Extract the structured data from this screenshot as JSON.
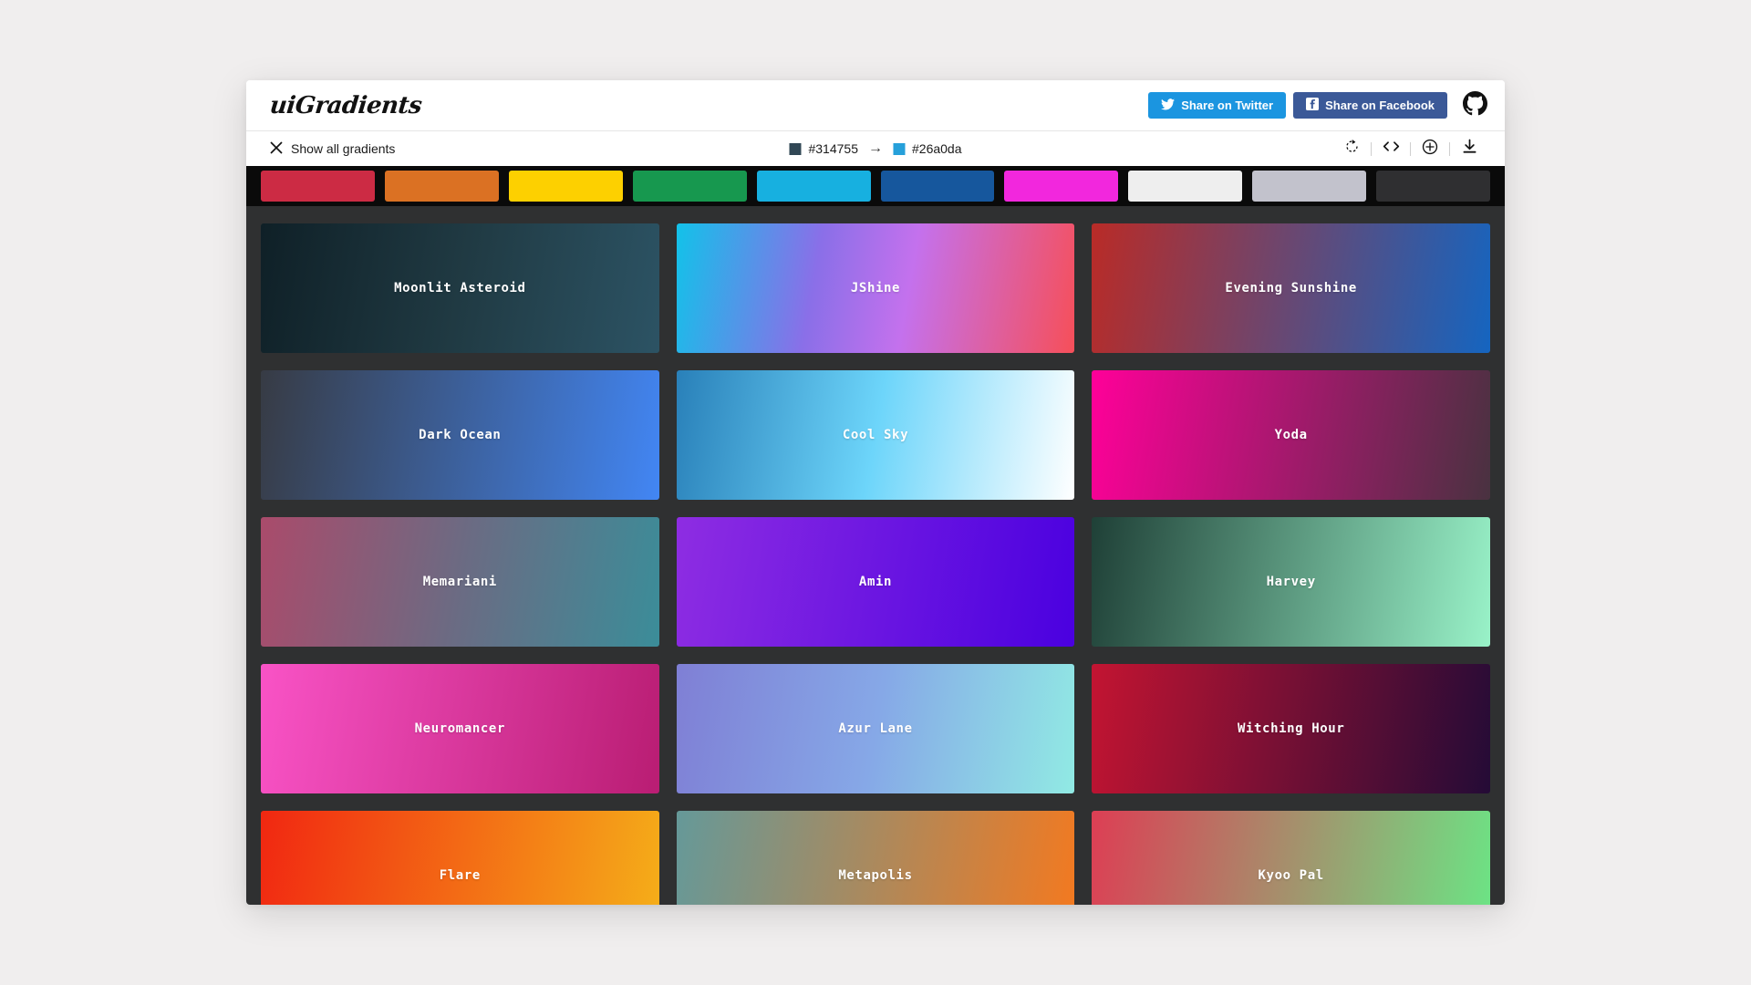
{
  "header": {
    "brand": "uiGradients",
    "share_twitter_label": "Share on Twitter",
    "share_facebook_label": "Share on Facebook",
    "twitter_color": "#1b95e0",
    "facebook_color": "#3b5998",
    "github_icon": "github-icon"
  },
  "toolbar": {
    "show_all_label": "Show all gradients",
    "close_icon": "close-icon",
    "current_gradient": {
      "from_hex": "#314755",
      "to_hex": "#26a0da",
      "arrow": "→"
    },
    "tools": [
      {
        "name": "rotate-gradient-button",
        "icon": "rotate-icon"
      },
      {
        "name": "view-code-button",
        "icon": "code-icon"
      },
      {
        "name": "add-gradient-button",
        "icon": "plus-circle-icon"
      },
      {
        "name": "download-button",
        "icon": "download-icon"
      }
    ]
  },
  "filter_swatches": [
    {
      "name": "filter-swatch-red",
      "color": "#cc2b44"
    },
    {
      "name": "filter-swatch-orange",
      "color": "#db7123"
    },
    {
      "name": "filter-swatch-yellow",
      "color": "#fdd000"
    },
    {
      "name": "filter-swatch-green",
      "color": "#17984f"
    },
    {
      "name": "filter-swatch-cyan",
      "color": "#17b0e0"
    },
    {
      "name": "filter-swatch-blue",
      "color": "#16579d"
    },
    {
      "name": "filter-swatch-magenta",
      "color": "#f227dd"
    },
    {
      "name": "filter-swatch-white",
      "color": "#eeeeee"
    },
    {
      "name": "filter-swatch-grey",
      "color": "#c2c2cc"
    },
    {
      "name": "filter-swatch-black",
      "color": "#2f2f31"
    }
  ],
  "gradients": [
    {
      "name": "Moonlit Asteroid",
      "css": "linear-gradient(100deg, #0f2027 0%, #203a43 50%, #2c5364 100%)"
    },
    {
      "name": "JShine",
      "css": "linear-gradient(100deg, #12c2e9 0%, #8a6fe8 35%, #c471ed 58%, #f64f59 100%)"
    },
    {
      "name": "Evening Sunshine",
      "css": "linear-gradient(100deg, #b92b27 0%, #1565c0 100%)"
    },
    {
      "name": "Dark Ocean",
      "css": "linear-gradient(100deg, #373b44 0%, #4286f4 100%)"
    },
    {
      "name": "Cool Sky",
      "css": "linear-gradient(100deg, #2980b9 0%, #6dd5fa 50%, #ffffff 100%)"
    },
    {
      "name": "Yoda",
      "css": "linear-gradient(100deg, #ff0099 0%, #493240 100%)"
    },
    {
      "name": "Memariani",
      "css": "linear-gradient(100deg, #aa4b6b 0%, #6b6b83 50%, #3b8d99 100%)"
    },
    {
      "name": "Amin",
      "css": "linear-gradient(100deg, #8e2de2 0%, #4a00e0 100%)"
    },
    {
      "name": "Harvey",
      "css": "linear-gradient(100deg, #1f4037 0%, #99f2c8 100%)"
    },
    {
      "name": "Neuromancer",
      "css": "linear-gradient(100deg, #f953c6 0%, #b91d73 100%)"
    },
    {
      "name": "Azur Lane",
      "css": "linear-gradient(100deg, #7f7fd5 0%, #86a8e7 50%, #91eae4 100%)"
    },
    {
      "name": "Witching Hour",
      "css": "linear-gradient(100deg, #c31432 0%, #240b36 100%)"
    },
    {
      "name": "Flare",
      "css": "linear-gradient(100deg, #f12711 0%, #f5af19 100%)"
    },
    {
      "name": "Metapolis",
      "css": "linear-gradient(100deg, #659999 0%, #f4791f 100%)"
    },
    {
      "name": "Kyoo Pal",
      "css": "linear-gradient(100deg, #dd3e54 0%, #6be585 100%)"
    }
  ]
}
